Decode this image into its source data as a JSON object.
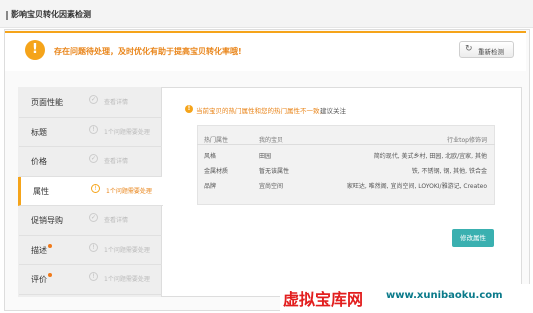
{
  "header": {
    "title": "影响宝贝转化因素检测"
  },
  "alert": {
    "icon": "exclamation-icon",
    "text": "存在问题待处理，及时优化有助于提高宝贝转化率哦!",
    "recheck_label": "重新检测",
    "recheck_icon": "refresh-icon"
  },
  "sidebar": {
    "items": [
      {
        "label": "页面性能",
        "status": "查看详情",
        "dot": false,
        "warn": false,
        "active": false
      },
      {
        "label": "标题",
        "status": "1个问题需要处理",
        "dot": false,
        "warn": false,
        "active": false
      },
      {
        "label": "价格",
        "status": "查看详情",
        "dot": false,
        "warn": false,
        "active": false
      },
      {
        "label": "属性",
        "status": "1个问题需要处理",
        "dot": false,
        "warn": true,
        "active": true
      },
      {
        "label": "促销导购",
        "status": "查看详情",
        "dot": false,
        "warn": false,
        "active": false
      },
      {
        "label": "描述",
        "status": "1个问题需要处理",
        "dot": true,
        "warn": false,
        "active": false
      },
      {
        "label": "评价",
        "status": "1个问题需要处理",
        "dot": true,
        "warn": false,
        "active": false
      }
    ]
  },
  "notice": {
    "text": "当前宝贝的热门属性和您的热门属性不一致，",
    "link": "建议关注"
  },
  "table": {
    "headers": [
      "热门属性",
      "我的宝贝",
      "行业top修饰词"
    ],
    "rows": [
      [
        "风格",
        "田园",
        "简约现代, 美式乡村, 田园, 北欧/宜家, 其他"
      ],
      [
        "金属材质",
        "暂无该属性",
        "铁, 不锈钢, 钢, 其他, 铁合金"
      ],
      [
        "品牌",
        "宜尚空间",
        "家旺达, 唯然阁, 宜尚空间, LOYOKI/雅游记, Createo"
      ]
    ]
  },
  "modify_button": {
    "label": "修改属性"
  },
  "watermark": {
    "cn": "虚拟宝库网",
    "url": "www.xunibaoku.com"
  },
  "colors": {
    "accent": "#f5a41a",
    "button": "#3ab0b0",
    "watermark_red": "#e21e1e"
  }
}
